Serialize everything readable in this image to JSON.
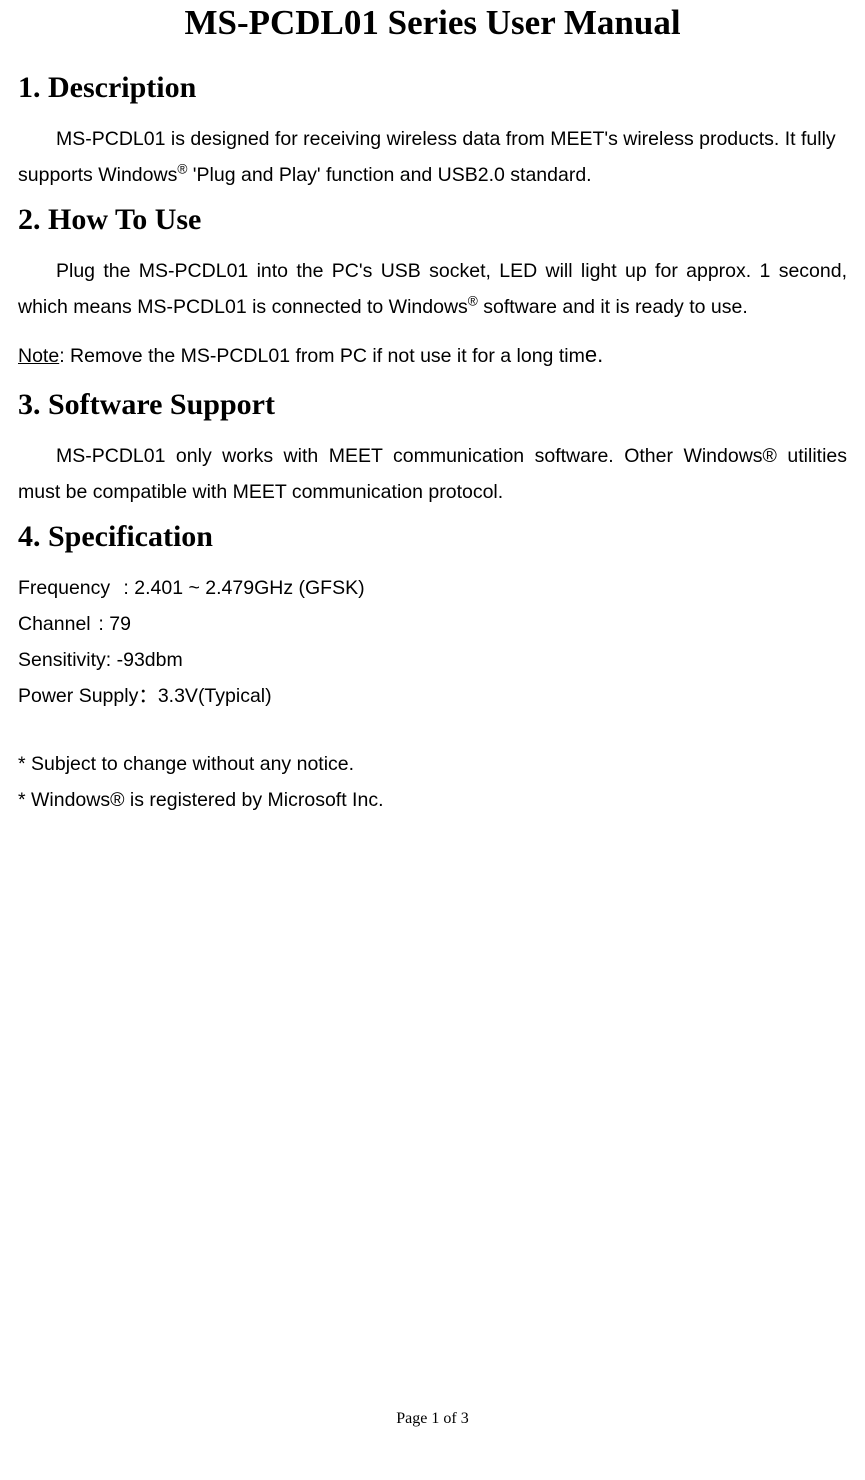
{
  "title": "MS-PCDL01 Series User Manual",
  "sections": {
    "s1": {
      "heading": "1. Description",
      "p1a": "MS-PCDL01 is designed for receiving wireless data from MEET's wireless products. It fully supports Windows",
      "p1b": " 'Plug and Play' function and USB2.0 standard."
    },
    "s2": {
      "heading": "2. How To Use",
      "p1a": "Plug the MS-PCDL01 into the PC's USB socket, LED will light up for approx. 1 second, which means MS-PCDL01 is connected to Windows",
      "p1b": " software and it is ready to use.",
      "note_label": "Note",
      "note_text": ": Remove the MS-PCDL01 from PC if not use it for a long tim",
      "note_end": "e."
    },
    "s3": {
      "heading": "3. Software Support",
      "p1": "MS-PCDL01 only works with MEET communication software. Other Windows® utilities must be compatible with MEET communication protocol."
    },
    "s4": {
      "heading": "4. Specification",
      "specs": {
        "freq_label": "Frequency",
        "freq_val": ": 2.401 ~ 2.479GHz (GFSK)",
        "channel_label": "Channel",
        "channel_val": ": 79",
        "sens_label": "Sensitivity",
        "sens_val": ": -93dbm",
        "power_label": "Power Supply",
        "power_val": "：3.3V(Typical)"
      }
    }
  },
  "footnotes": {
    "f1": "* Subject to change without any notice.",
    "f2": "* Windows® is registered by Microsoft Inc."
  },
  "reg_mark": "®",
  "page_number": "Page 1 of 3"
}
